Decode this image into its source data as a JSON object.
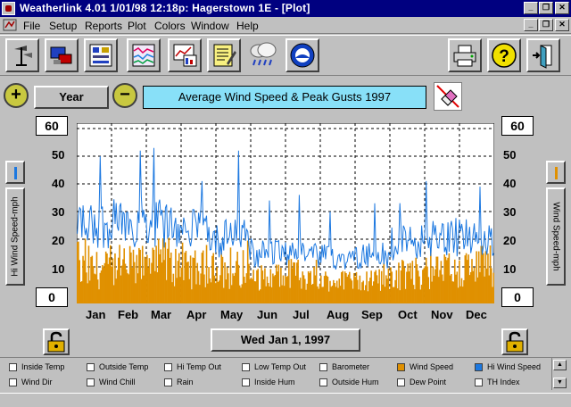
{
  "window": {
    "title": "Weatherlink 4.01    1/01/98  12:18p: Hagerstown 1E - [Plot]",
    "minimize_glyph": "_",
    "restore_glyph": "❐",
    "close_glyph": "✕"
  },
  "menu": {
    "items": [
      {
        "label": "File"
      },
      {
        "label": "Setup"
      },
      {
        "label": "Reports"
      },
      {
        "label": "Plot"
      },
      {
        "label": "Colors"
      },
      {
        "label": "Window"
      },
      {
        "label": "Help"
      }
    ]
  },
  "toolbar": {
    "icons": [
      "weather-station-icon",
      "computer-download-icon",
      "bulletin-icon",
      "strip-chart-icon",
      "plot-icon",
      "notepad-icon",
      "storm-cloud-icon",
      "noaa-logo-icon",
      "printer-icon",
      "help-icon",
      "exit-icon"
    ]
  },
  "controls": {
    "zoom_in_glyph": "+",
    "zoom_out_glyph": "−",
    "period_label": "Year",
    "plot_title": "Average Wind Speed & Peak Gusts 1997",
    "date_label": "Wed Jan 1, 1997"
  },
  "axes": {
    "left_top": "60",
    "left_bottom": "0",
    "right_top": "60",
    "right_bottom": "0",
    "left_caption": "Hi Wind Speed-mph",
    "right_caption": "Wind Speed-mph",
    "ticks": [
      "50",
      "40",
      "30",
      "20",
      "10"
    ]
  },
  "months": [
    "Jan",
    "Feb",
    "Mar",
    "Apr",
    "May",
    "Jun",
    "Jul",
    "Aug",
    "Sep",
    "Oct",
    "Nov",
    "Dec"
  ],
  "colors": {
    "wind_speed": "#e09000",
    "hi_wind_speed": "#1c78e0",
    "grid": "#000000"
  },
  "legend": {
    "items": [
      {
        "label": "Inside Temp",
        "checked": false
      },
      {
        "label": "Outside Temp",
        "checked": false
      },
      {
        "label": "Hi Temp Out",
        "checked": false
      },
      {
        "label": "Low Temp Out",
        "checked": false
      },
      {
        "label": "Barometer",
        "checked": false
      },
      {
        "label": "Wind Speed",
        "checked": true
      },
      {
        "label": "Hi Wind Speed",
        "checked": true
      },
      {
        "label": "Wind Dir",
        "checked": false
      },
      {
        "label": "Wind Chill",
        "checked": false
      },
      {
        "label": "Rain",
        "checked": false
      },
      {
        "label": "Inside Hum",
        "checked": false
      },
      {
        "label": "Outside Hum",
        "checked": false
      },
      {
        "label": "Dew Point",
        "checked": false
      },
      {
        "label": "TH Index",
        "checked": false
      }
    ]
  },
  "chart_data": {
    "type": "area",
    "title": "Average Wind Speed & Peak Gusts 1997",
    "ylim": [
      0,
      60
    ],
    "yticks": [
      0,
      10,
      20,
      30,
      40,
      50,
      60
    ],
    "ylabel_left": "Hi Wind Speed-mph",
    "ylabel_right": "Wind Speed-mph",
    "categories": [
      "Jan",
      "Feb",
      "Mar",
      "Apr",
      "May",
      "Jun",
      "Jul",
      "Aug",
      "Sep",
      "Oct",
      "Nov",
      "Dec"
    ],
    "grid": true,
    "series": [
      {
        "name": "Hi Wind Speed",
        "type": "line",
        "peak_mph": [
          50,
          52,
          53,
          41,
          52,
          34,
          36,
          30,
          33,
          33,
          41,
          39
        ],
        "typical_mph": [
          30,
          31,
          30,
          27,
          24,
          18,
          17,
          16,
          17,
          22,
          25,
          24
        ]
      },
      {
        "name": "Wind Speed",
        "type": "area",
        "peak_mph": [
          21,
          21,
          22,
          20,
          21,
          12,
          13,
          11,
          12,
          15,
          17,
          18
        ],
        "typical_mph": [
          9,
          10,
          10,
          9,
          8,
          6,
          5,
          5,
          5,
          7,
          8,
          9
        ]
      }
    ]
  }
}
